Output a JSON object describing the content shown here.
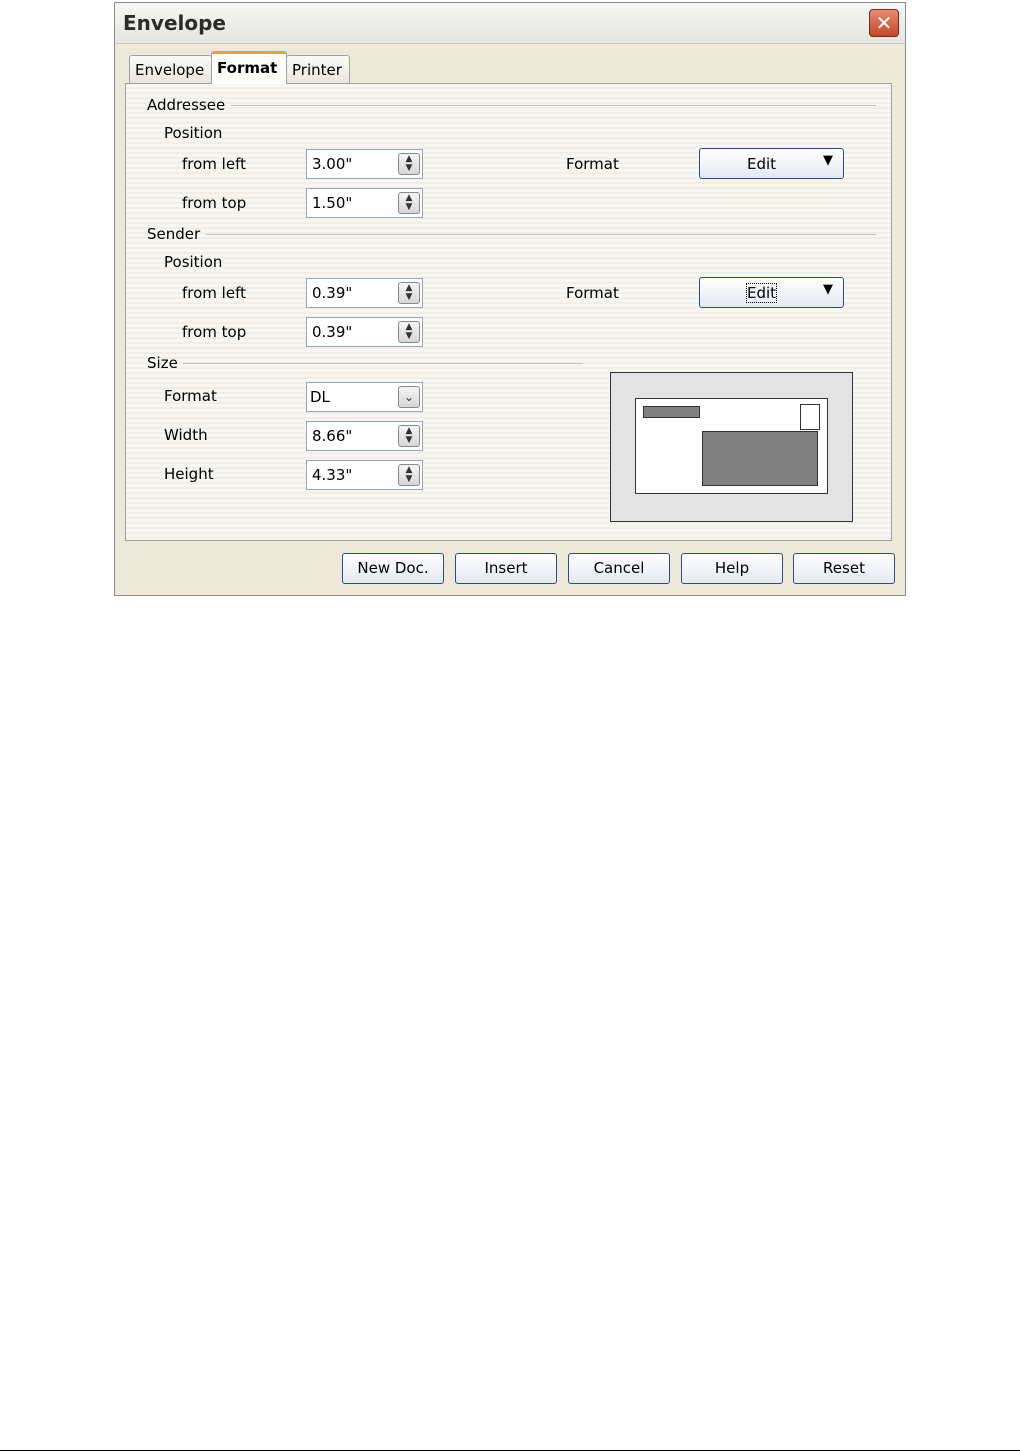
{
  "window": {
    "title": "Envelope",
    "close_icon": "close-icon"
  },
  "tabs": [
    {
      "label": "Envelope",
      "active": false
    },
    {
      "label": "Format",
      "active": true
    },
    {
      "label": "Printer",
      "active": false
    }
  ],
  "addressee": {
    "section_label": "Addressee",
    "position_label": "Position",
    "from_left_label": "from left",
    "from_left_value": "3.00\"",
    "from_top_label": "from top",
    "from_top_value": "1.50\"",
    "format_label": "Format",
    "edit_label": "Edit"
  },
  "sender": {
    "section_label": "Sender",
    "position_label": "Position",
    "from_left_label": "from left",
    "from_left_value": "0.39\"",
    "from_top_label": "from top",
    "from_top_value": "0.39\"",
    "format_label": "Format",
    "edit_label": "Edit"
  },
  "size": {
    "section_label": "Size",
    "format_label": "Format",
    "format_value": "DL",
    "width_label": "Width",
    "width_value": "8.66\"",
    "height_label": "Height",
    "height_value": "4.33\""
  },
  "buttons": {
    "new_doc": "New Doc.",
    "insert": "Insert",
    "cancel": "Cancel",
    "help": "Help",
    "reset": "Reset"
  },
  "icons": {
    "spin": "spin-updown-icon",
    "dropdown": "chevron-down-icon",
    "menu_arrow": "triangle-down-icon"
  }
}
